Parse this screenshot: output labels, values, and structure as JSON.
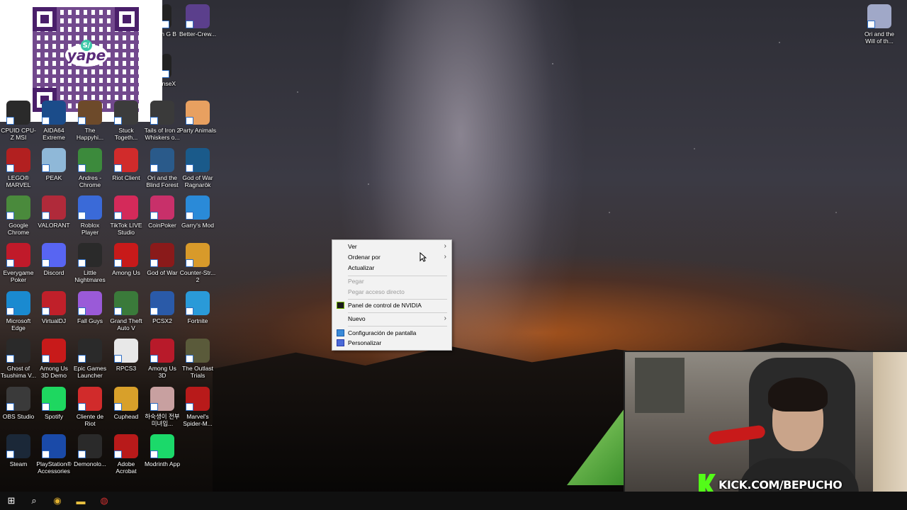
{
  "qr": {
    "logo_text": "yape",
    "badge_text": "S/"
  },
  "desktop_icons": [
    {
      "label": "Better-Crew...",
      "color": "#5b3f8c"
    },
    {
      "label": "CPUID CPU-Z MSI",
      "color": "#2a2a2a"
    },
    {
      "label": "AIDA64 Extreme",
      "color": "#1b4c8a"
    },
    {
      "label": "The Happyhi...",
      "color": "#6d4a2a"
    },
    {
      "label": "Stuck Togeth...",
      "color": "#3c3c3c"
    },
    {
      "label": "Tails of Iron 2 Whiskers o...",
      "color": "#3a3a3a"
    },
    {
      "label": "Party Animals",
      "color": "#e8a060"
    },
    {
      "label": "LEGO® MARVEL Su...",
      "color": "#b22020"
    },
    {
      "label": "PEAK",
      "color": "#8fb8d8"
    },
    {
      "label": "Andres - Chrome",
      "color": "#3c8a3c"
    },
    {
      "label": "Riot Client",
      "color": "#d12b2b"
    },
    {
      "label": "Ori and the Blind Forest",
      "color": "#2a5a8a"
    },
    {
      "label": "God of War Ragnarök",
      "color": "#1a5a8a"
    },
    {
      "label": "Google Chrome",
      "color": "#4a8a3c"
    },
    {
      "label": "VALORANT",
      "color": "#b02a3a"
    },
    {
      "label": "Roblox Player",
      "color": "#3a6ad8"
    },
    {
      "label": "TikTok LIVE Studio",
      "color": "#d42a5a"
    },
    {
      "label": "CoinPoker",
      "color": "#c8306a"
    },
    {
      "label": "Garry's Mod",
      "color": "#2a8ad8"
    },
    {
      "label": "Everygame Poker",
      "color": "#c01a2a"
    },
    {
      "label": "Discord",
      "color": "#5865f2"
    },
    {
      "label": "Little Nightmares",
      "color": "#2a2a2a"
    },
    {
      "label": "Among Us",
      "color": "#c81a1a"
    },
    {
      "label": "God of War",
      "color": "#8a1a1a"
    },
    {
      "label": "Counter-Str... 2",
      "color": "#d89a2a"
    },
    {
      "label": "Microsoft Edge",
      "color": "#1a8ad0"
    },
    {
      "label": "VirtualDJ",
      "color": "#c0202a"
    },
    {
      "label": "Fall Guys",
      "color": "#9a5ad8"
    },
    {
      "label": "Grand Theft Auto V",
      "color": "#3a7a3a"
    },
    {
      "label": "PCSX2",
      "color": "#2a5aa8"
    },
    {
      "label": "Fortnite",
      "color": "#2a9ad8"
    },
    {
      "label": "Ghost of Tsushima V...",
      "color": "#2a2a2a"
    },
    {
      "label": "Among Us 3D Demo",
      "color": "#c81a1a"
    },
    {
      "label": "Epic Games Launcher",
      "color": "#2a2a2a"
    },
    {
      "label": "RPCS3",
      "color": "#e8e8e8"
    },
    {
      "label": "Among Us 3D",
      "color": "#b81a2a"
    },
    {
      "label": "The Outlast Trials",
      "color": "#5a5a3a"
    },
    {
      "label": "OBS Studio",
      "color": "#3a3a3a"
    },
    {
      "label": "Spotify",
      "color": "#1ed760"
    },
    {
      "label": "Cliente de Riot",
      "color": "#d12b2b"
    },
    {
      "label": "Cuphead",
      "color": "#d8a02a"
    },
    {
      "label": "하숙생이 전부 미녀입...",
      "color": "#c8a0a0"
    },
    {
      "label": "Marvel's Spider-M...",
      "color": "#b81a1a"
    },
    {
      "label": "Steam",
      "color": "#1b2838"
    },
    {
      "label": "PlayStation® Accessories",
      "color": "#1a4aa8"
    },
    {
      "label": "Demonolo...",
      "color": "#2a2a2a"
    },
    {
      "label": "Adobe Acrobat",
      "color": "#b81a1a"
    },
    {
      "label": "Modrinth App",
      "color": "#1bd96a"
    },
    {
      "label": "Ori and the Will of th...",
      "color": "#a0a8c8"
    }
  ],
  "partial_labels": [
    "ch G B",
    "enseX"
  ],
  "context_menu": {
    "items": [
      {
        "label": "Ver",
        "submenu": true,
        "disabled": false
      },
      {
        "label": "Ordenar por",
        "submenu": true,
        "disabled": false
      },
      {
        "label": "Actualizar",
        "submenu": false,
        "disabled": false
      },
      {
        "label": "Pegar",
        "submenu": false,
        "disabled": true
      },
      {
        "label": "Pegar acceso directo",
        "submenu": false,
        "disabled": true
      },
      {
        "label": "Panel de control de NVIDIA",
        "submenu": false,
        "disabled": false,
        "icon": "nvidia-icon"
      },
      {
        "label": "Nuevo",
        "submenu": true,
        "disabled": false
      },
      {
        "label": "Configuración de pantalla",
        "submenu": false,
        "disabled": false,
        "icon": "display-icon"
      },
      {
        "label": "Personalizar",
        "submenu": false,
        "disabled": false,
        "icon": "personalize-icon"
      }
    ]
  },
  "webcam": {
    "overlay_text": "KICK.COM/BEPUCHO"
  },
  "taskbar": {
    "items": [
      {
        "name": "start-icon",
        "glyph": "⊞"
      },
      {
        "name": "search-icon",
        "glyph": "⌕"
      },
      {
        "name": "chrome-icon",
        "glyph": "◉"
      },
      {
        "name": "file-explorer-icon",
        "glyph": "▬"
      },
      {
        "name": "obs-icon",
        "glyph": "◍"
      }
    ]
  },
  "colors": {
    "nvidia": "#76b900",
    "kick": "#53fc18"
  }
}
